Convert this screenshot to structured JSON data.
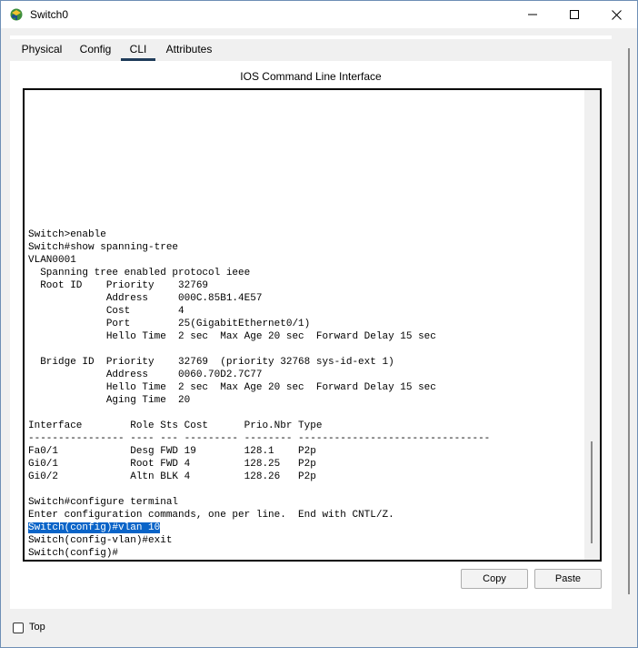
{
  "window": {
    "title": "Switch0"
  },
  "tabs": [
    {
      "label": "Physical"
    },
    {
      "label": "Config"
    },
    {
      "label": "CLI",
      "active": true
    },
    {
      "label": "Attributes"
    }
  ],
  "panel": {
    "title": "IOS Command Line Interface"
  },
  "terminal": {
    "lines": [
      "Switch>enable",
      "Switch#show spanning-tree",
      "VLAN0001",
      "  Spanning tree enabled protocol ieee",
      "  Root ID    Priority    32769",
      "             Address     000C.85B1.4E57",
      "             Cost        4",
      "             Port        25(GigabitEthernet0/1)",
      "             Hello Time  2 sec  Max Age 20 sec  Forward Delay 15 sec",
      "",
      "  Bridge ID  Priority    32769  (priority 32768 sys-id-ext 1)",
      "             Address     0060.70D2.7C77",
      "             Hello Time  2 sec  Max Age 20 sec  Forward Delay 15 sec",
      "             Aging Time  20",
      "",
      "Interface        Role Sts Cost      Prio.Nbr Type",
      "---------------- ---- --- --------- -------- --------------------------------",
      "Fa0/1            Desg FWD 19        128.1    P2p",
      "Gi0/1            Root FWD 4         128.25   P2p",
      "Gi0/2            Altn BLK 4         128.26   P2p",
      "",
      "Switch#configure terminal",
      "Enter configuration commands, one per line.  End with CNTL/Z.",
      "Switch(config)#vlan 10",
      "Switch(config-vlan)#exit",
      "Switch(config)#"
    ],
    "highlighted_line_index": 23
  },
  "buttons": {
    "copy": "Copy",
    "paste": "Paste"
  },
  "bottom": {
    "top_checkbox_label": "Top",
    "top_checked": false
  },
  "colors": {
    "selection": "#0a64c8",
    "tab_underline": "#1f3c5a"
  }
}
